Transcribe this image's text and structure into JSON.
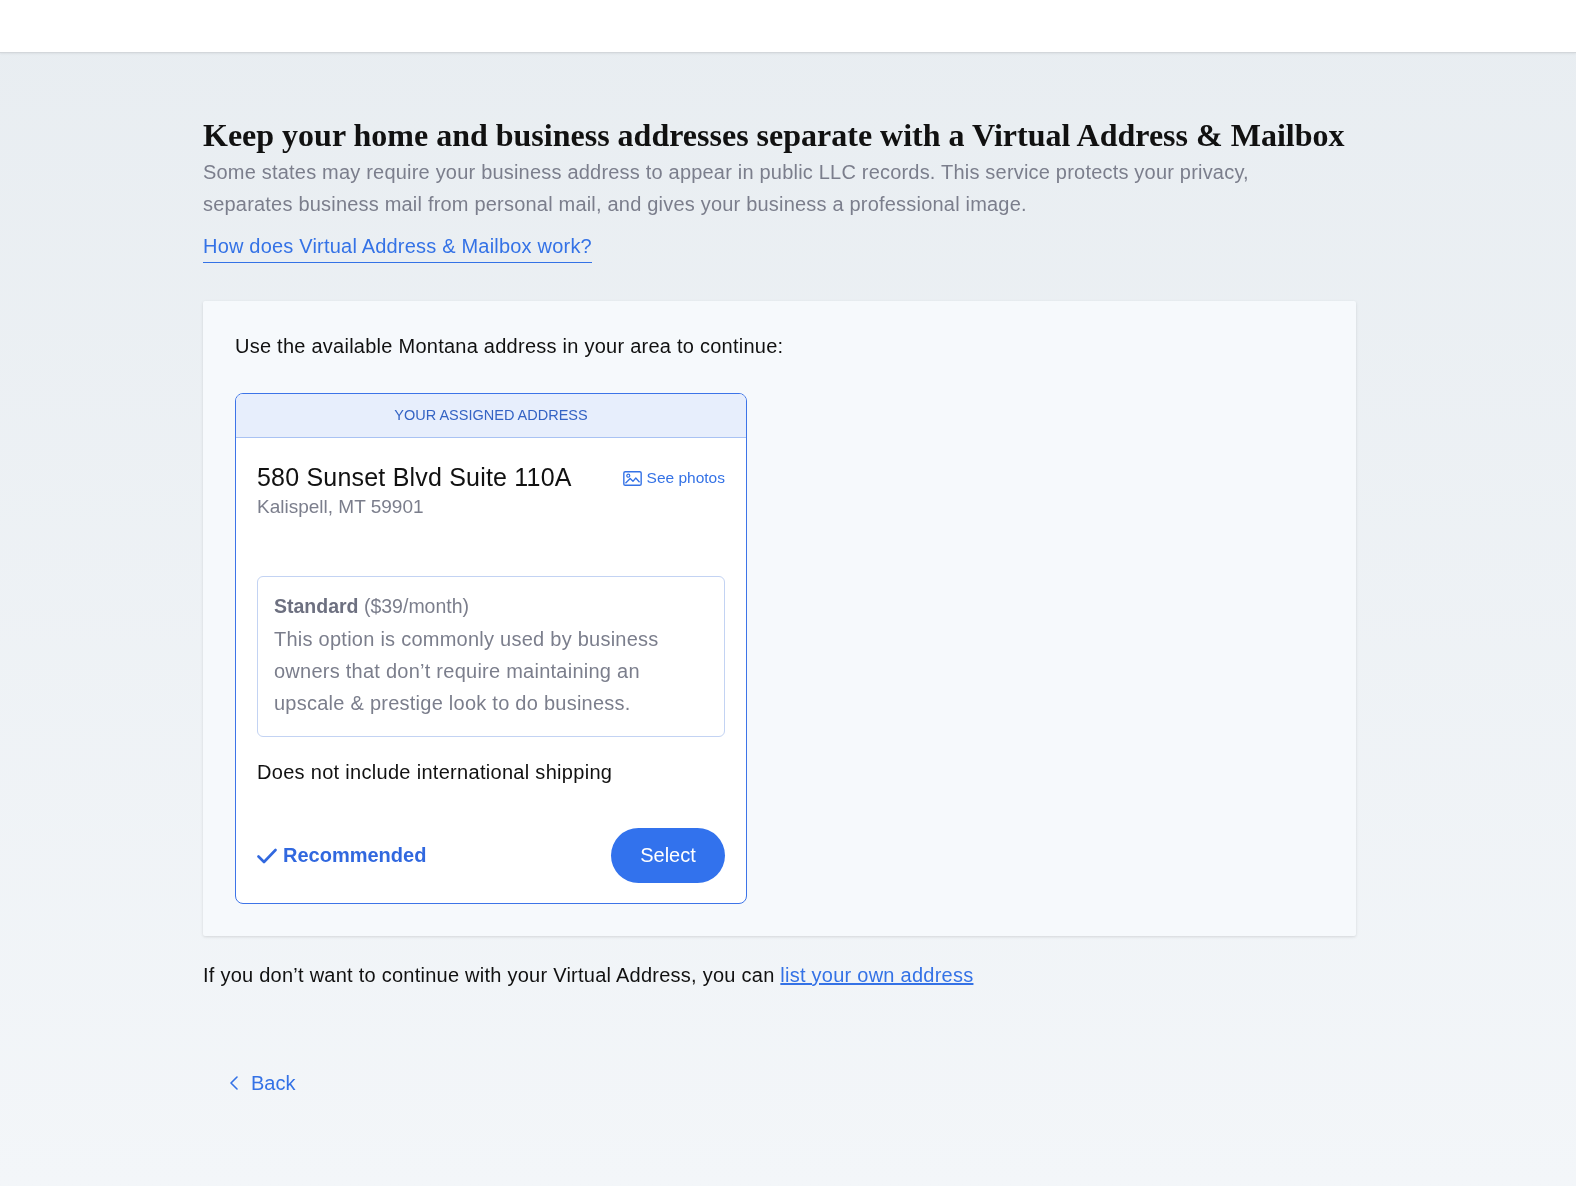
{
  "heading": "Keep your home and business addresses separate with a Virtual Address & Mailbox",
  "intro": "Some states may require your business address to appear in public LLC records. This service protects your privacy, separates business mail from personal mail, and gives your business a professional image.",
  "help_link": "How does Virtual Address & Mailbox work?",
  "panel": {
    "prompt": "Use the available Montana address in your area to continue:",
    "address_card": {
      "header": "YOUR ASSIGNED ADDRESS",
      "street": "580 Sunset Blvd Suite 110A",
      "city_line": "Kalispell, MT 59901",
      "photos_link": "See photos",
      "plan": {
        "summary": "**Standard** ($39/month)",
        "description": "This option is commonly used by business owners that don’t require maintaining an upscale & prestige look to do business."
      },
      "note": "Does not include international shipping",
      "recommended": {
        "label": "Recommended",
        "on": true
      },
      "select_button": "Select"
    }
  },
  "footer": {
    "text": "If you don’t want to continue with your Virtual Address, you can",
    "link": "list your own address"
  },
  "back_link": "Back"
}
